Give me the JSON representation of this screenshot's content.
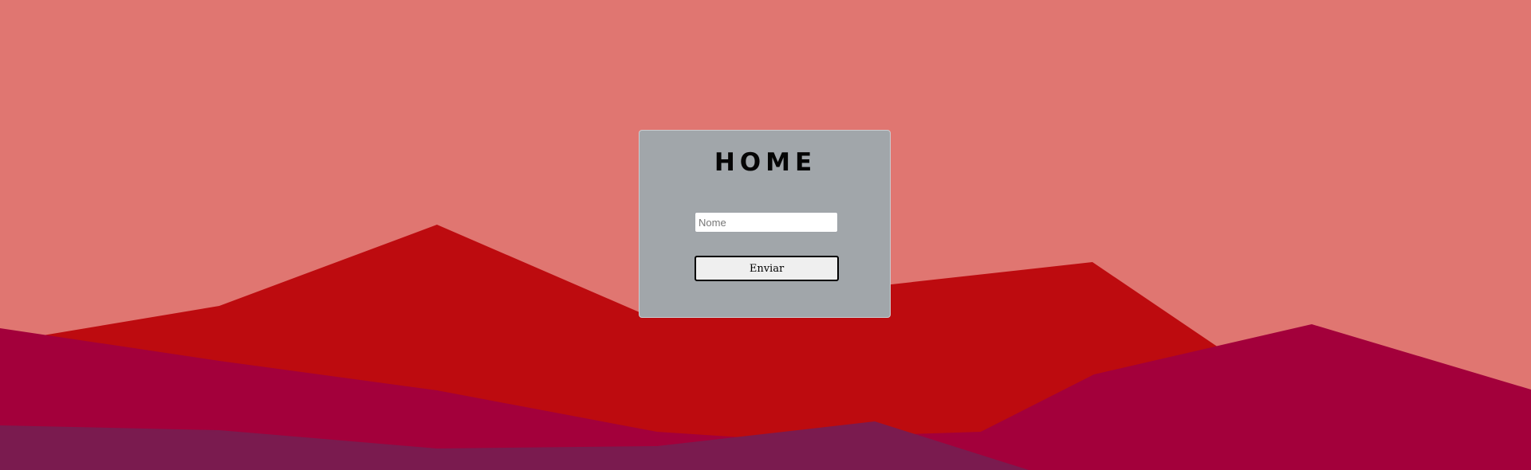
{
  "page": {
    "background_color": "#e07671",
    "mountain_colors": {
      "back_red": "#bd0b0f",
      "middle_crimson": "#a3003b",
      "front_purple": "#7a1b4f"
    }
  },
  "form": {
    "title": "HOME",
    "name_field": {
      "value": "",
      "placeholder": "Nome"
    },
    "submit_label": "Enviar",
    "card_color": "#a1a6aa"
  }
}
